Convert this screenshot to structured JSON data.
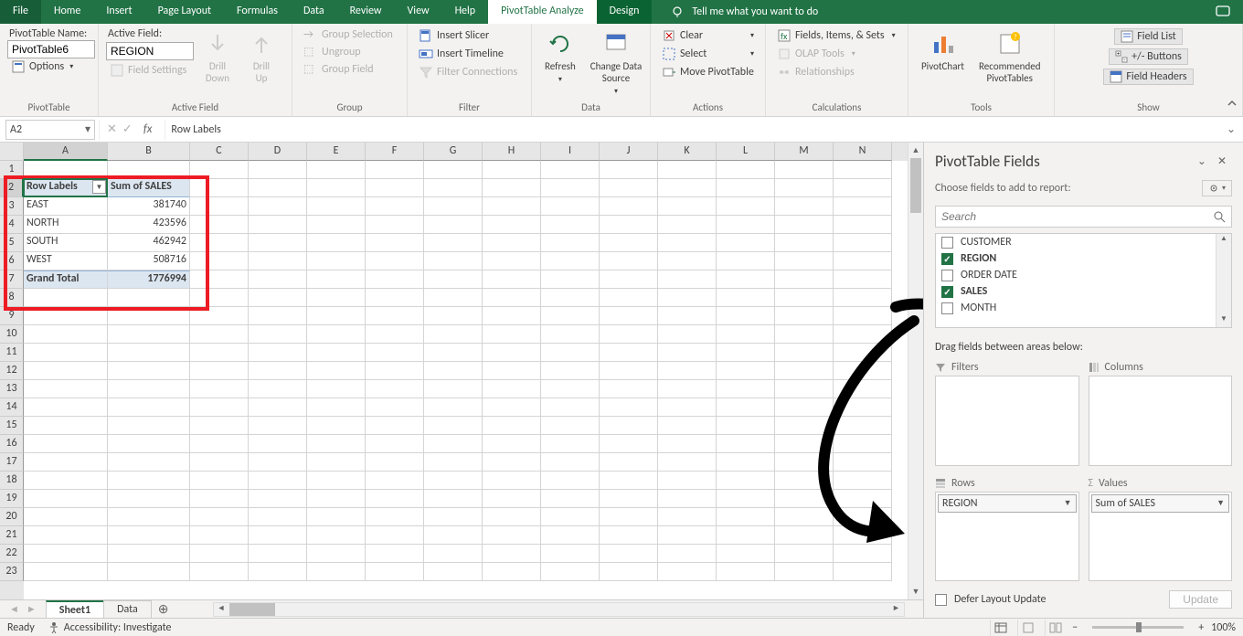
{
  "titlebar": {
    "tabs": [
      "File",
      "Home",
      "Insert",
      "Page Layout",
      "Formulas",
      "Data",
      "Review",
      "View",
      "Help",
      "PivotTable Analyze",
      "Design"
    ],
    "active_tab": "PivotTable Analyze",
    "tell_me": "Tell me what you want to do"
  },
  "ribbon": {
    "pivottable": {
      "name_label": "PivotTable Name:",
      "name_value": "PivotTable6",
      "options": "Options",
      "group": "PivotTable"
    },
    "active_field": {
      "label": "Active Field:",
      "value": "REGION",
      "drill_down": "Drill\nDown",
      "drill_up": "Drill\nUp",
      "settings": "Field Settings",
      "group": "Active Field"
    },
    "group_grp": {
      "sel": "Group Selection",
      "ungroup": "Ungroup",
      "field": "Group Field",
      "group": "Group"
    },
    "filter": {
      "slicer": "Insert Slicer",
      "timeline": "Insert Timeline",
      "conn": "Filter Connections",
      "group": "Filter"
    },
    "data": {
      "refresh": "Refresh",
      "change": "Change Data\nSource",
      "group": "Data"
    },
    "actions": {
      "clear": "Clear",
      "select": "Select",
      "move": "Move PivotTable",
      "group": "Actions"
    },
    "calc": {
      "fis": "Fields, Items, & Sets",
      "olap": "OLAP Tools",
      "rel": "Relationships",
      "group": "Calculations"
    },
    "tools": {
      "chart": "PivotChart",
      "rec": "Recommended\nPivotTables",
      "group": "Tools"
    },
    "show": {
      "fl": "Field List",
      "pm": "+/- Buttons",
      "fh": "Field Headers",
      "group": "Show"
    }
  },
  "formula": {
    "name_box": "A2",
    "value": "Row Labels"
  },
  "columns": [
    "A",
    "B",
    "C",
    "D",
    "E",
    "F",
    "G",
    "H",
    "I",
    "J",
    "K",
    "L",
    "M",
    "N"
  ],
  "rows": [
    1,
    2,
    3,
    4,
    5,
    6,
    7,
    8,
    9,
    10,
    11,
    12,
    13,
    14,
    15,
    16,
    17,
    18,
    19,
    20,
    21,
    22,
    23
  ],
  "pivot": {
    "row_labels_hdr": "Row Labels",
    "sum_hdr": "Sum of SALES",
    "rows": [
      {
        "label": "EAST",
        "val": "381740"
      },
      {
        "label": "NORTH",
        "val": "423596"
      },
      {
        "label": "SOUTH",
        "val": "462942"
      },
      {
        "label": "WEST",
        "val": "508716"
      }
    ],
    "grand_label": "Grand Total",
    "grand_val": "1776994"
  },
  "sheets": {
    "active": "Sheet1",
    "other": "Data"
  },
  "status": {
    "ready": "Ready",
    "acc": "Accessibility: Investigate",
    "zoom": "100%"
  },
  "pane": {
    "title": "PivotTable Fields",
    "choose": "Choose fields to add to report:",
    "search_ph": "Search",
    "fields": [
      {
        "name": "CUSTOMER",
        "checked": false
      },
      {
        "name": "REGION",
        "checked": true
      },
      {
        "name": "ORDER DATE",
        "checked": false
      },
      {
        "name": "SALES",
        "checked": true
      },
      {
        "name": "MONTH",
        "checked": false
      }
    ],
    "drag": "Drag fields between areas below:",
    "area_filters": "Filters",
    "area_columns": "Columns",
    "area_rows": "Rows",
    "area_values": "Values",
    "rows_item": "REGION",
    "values_item": "Sum of SALES",
    "defer": "Defer Layout Update",
    "update": "Update"
  }
}
